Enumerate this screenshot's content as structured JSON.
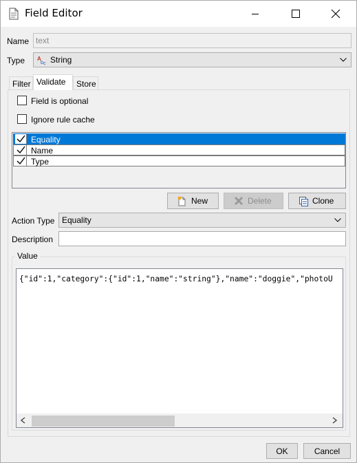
{
  "window": {
    "title": "Field Editor"
  },
  "fields": {
    "name_label": "Name",
    "name_value": "text",
    "type_label": "Type",
    "type_value": "String",
    "type_icon": "string-type-icon"
  },
  "tabs": [
    {
      "label": "Filter",
      "active": false
    },
    {
      "label": "Validate",
      "active": true
    },
    {
      "label": "Store",
      "active": false
    }
  ],
  "options": {
    "field_optional": {
      "label": "Field is optional",
      "checked": false
    },
    "ignore_cache": {
      "label": "Ignore rule cache",
      "checked": false
    }
  },
  "rules": [
    {
      "label": "Equality",
      "checked": true,
      "selected": true
    },
    {
      "label": "Name",
      "checked": true,
      "selected": false
    },
    {
      "label": "Type",
      "checked": true,
      "selected": false
    }
  ],
  "rule_buttons": {
    "new": {
      "label": "New",
      "enabled": true
    },
    "delete": {
      "label": "Delete",
      "enabled": false
    },
    "clone": {
      "label": "Clone",
      "enabled": true
    }
  },
  "action": {
    "type_label": "Action Type",
    "type_value": "Equality",
    "description_label": "Description",
    "description_value": ""
  },
  "value": {
    "legend": "Value",
    "text": "{\"id\":1,\"category\":{\"id\":1,\"name\":\"string\"},\"name\":\"doggie\",\"photoU"
  },
  "dialog_buttons": {
    "ok": "OK",
    "cancel": "Cancel"
  },
  "colors": {
    "selection": "#0078d7",
    "window_bg": "#f0f0f0"
  }
}
